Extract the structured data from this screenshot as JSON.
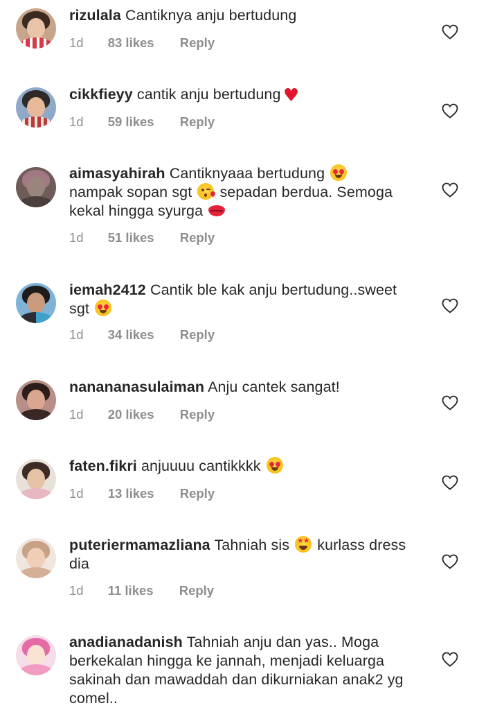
{
  "comments": [
    {
      "username": "rizulala",
      "text": "Cantiknya anju bertudung",
      "time": "1d",
      "likes": "83 likes",
      "reply": "Reply"
    },
    {
      "username": "cikkfieyy",
      "text": "cantik anju bertudung",
      "time": "1d",
      "likes": "59 likes",
      "reply": "Reply"
    },
    {
      "username": "aimasyahirah",
      "text_parts": [
        "Cantiknyaaa bertudung",
        "nampak sopan sgt",
        "sepadan berdua. Semoga kekal hingga syurga"
      ],
      "time": "1d",
      "likes": "51 likes",
      "reply": "Reply"
    },
    {
      "username": "iemah2412",
      "text": "Cantik ble kak anju bertudung..sweet sgt",
      "time": "1d",
      "likes": "34 likes",
      "reply": "Reply"
    },
    {
      "username": "nanananasulaiman",
      "text": "Anju cantek sangat!",
      "time": "1d",
      "likes": "20 likes",
      "reply": "Reply"
    },
    {
      "username": "faten.fikri",
      "text": "anjuuuu cantikkkk",
      "time": "1d",
      "likes": "13 likes",
      "reply": "Reply"
    },
    {
      "username": "puteriermamazliana",
      "text_parts": [
        "Tahniah sis",
        "kurlass dress dia"
      ],
      "time": "1d",
      "likes": "11 likes",
      "reply": "Reply"
    },
    {
      "username": "anadianadanish",
      "text": "Tahniah anju dan yas.. Moga berkekalan hingga ke jannah, menjadi keluarga sakinah dan mawaddah dan dikurniakan anak2 yg comel.."
    }
  ],
  "icons": {
    "like": "heart-outline-icon",
    "emoji_heart_eyes": "heart-eyes-emoji",
    "emoji_kiss": "kissing-heart-emoji",
    "emoji_lips": "kiss-mark-emoji",
    "emoji_star_struck": "star-struck-emoji",
    "emoji_red_heart": "red-heart-emoji"
  },
  "colors": {
    "text": "#262626",
    "meta": "#8e8e8e",
    "red_heart": "#e0172c"
  }
}
